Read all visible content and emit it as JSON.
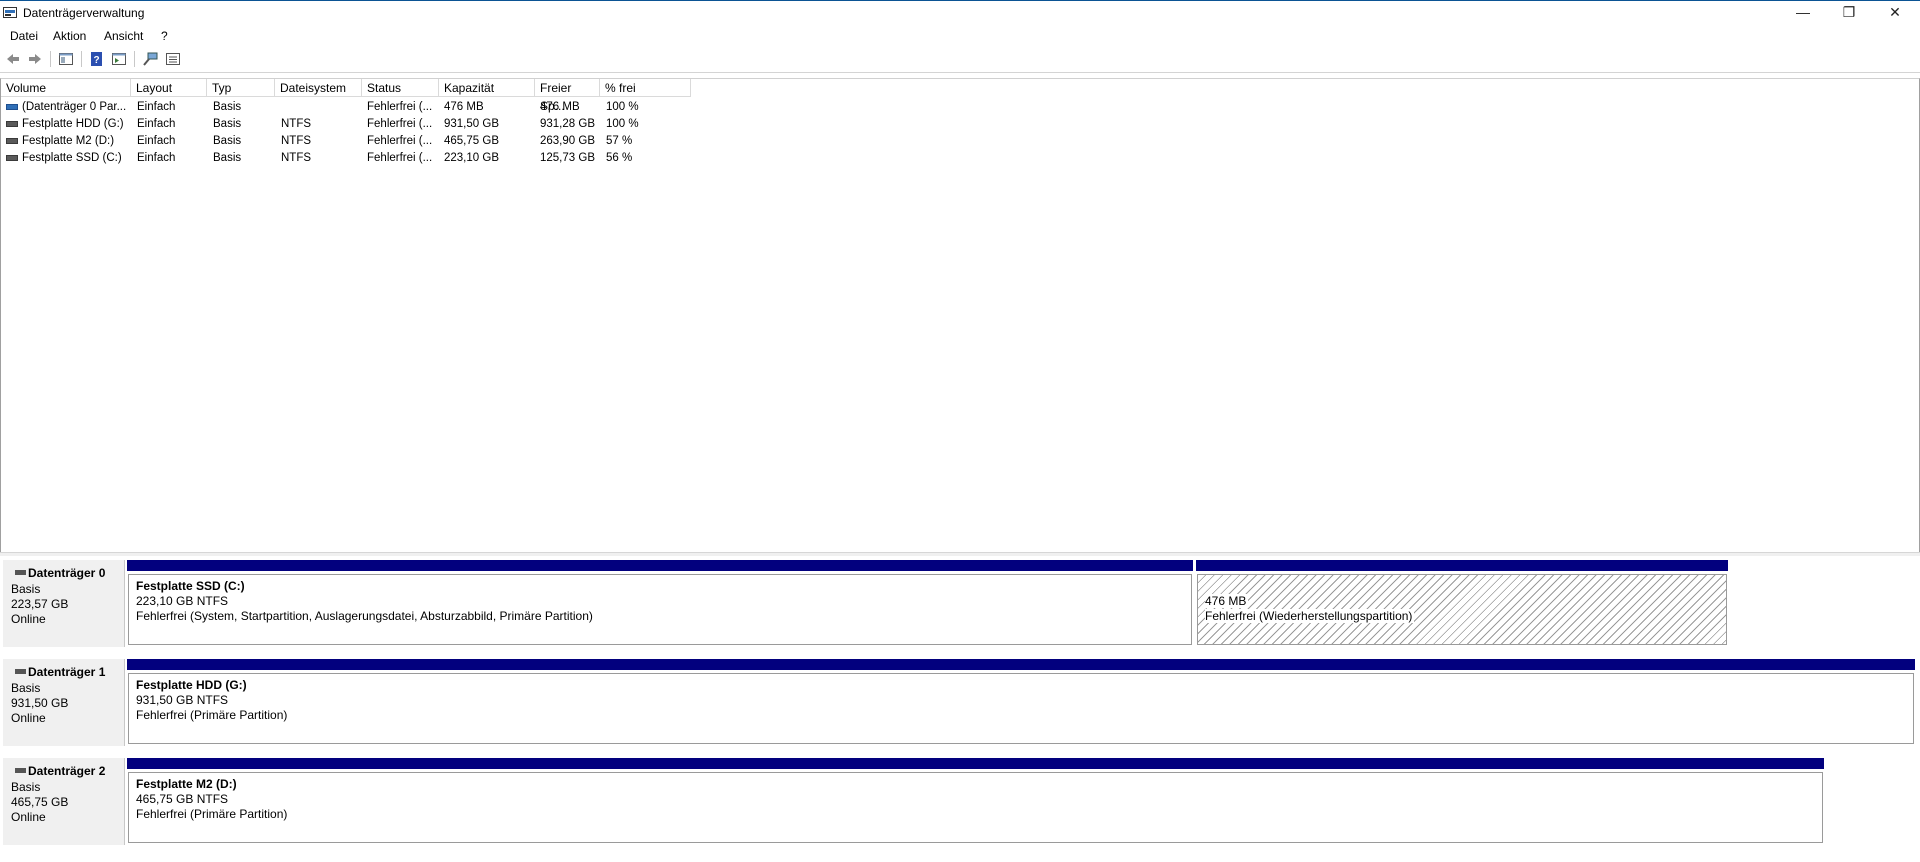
{
  "window": {
    "title": "Datenträgerverwaltung",
    "controls": {
      "minimize": "—",
      "restore": "❐",
      "close": "✕"
    }
  },
  "menu": [
    "Datei",
    "Aktion",
    "Ansicht",
    "?"
  ],
  "toolbar": {
    "icons": [
      "back-icon",
      "forward-icon",
      "console-tree-icon",
      "help-icon",
      "properties-icon",
      "connect-icon",
      "settings-icon"
    ]
  },
  "volume_table": {
    "columns": [
      "Volume",
      "Layout",
      "Typ",
      "Dateisystem",
      "Status",
      "Kapazität",
      "Freier Sp...",
      "% frei"
    ],
    "rows": [
      {
        "volume": "(Datenträger 0 Par...",
        "layout": "Einfach",
        "typ": "Basis",
        "dateisystem": "",
        "status": "Fehlerfrei (...",
        "kapazitaet": "476 MB",
        "frei": "476 MB",
        "prozent": "100 %"
      },
      {
        "volume": "Festplatte HDD (G:)",
        "layout": "Einfach",
        "typ": "Basis",
        "dateisystem": "NTFS",
        "status": "Fehlerfrei (...",
        "kapazitaet": "931,50 GB",
        "frei": "931,28 GB",
        "prozent": "100 %"
      },
      {
        "volume": "Festplatte M2 (D:)",
        "layout": "Einfach",
        "typ": "Basis",
        "dateisystem": "NTFS",
        "status": "Fehlerfrei (...",
        "kapazitaet": "465,75 GB",
        "frei": "263,90 GB",
        "prozent": "57 %"
      },
      {
        "volume": "Festplatte SSD (C:)",
        "layout": "Einfach",
        "typ": "Basis",
        "dateisystem": "NTFS",
        "status": "Fehlerfrei (...",
        "kapazitaet": "223,10 GB",
        "frei": "125,73 GB",
        "prozent": "56 %"
      }
    ]
  },
  "disks": [
    {
      "name": "Datenträger 0",
      "type": "Basis",
      "size": "223,57 GB",
      "state": "Online",
      "partitions": [
        {
          "title": "Festplatte SSD  (C:)",
          "size": "223,10 GB NTFS",
          "status": "Fehlerfrei (System, Startpartition, Auslagerungsdatei, Absturzabbild, Primäre Partition)"
        },
        {
          "title": "",
          "size": "476 MB",
          "status": "Fehlerfrei (Wiederherstellungspartition)"
        }
      ]
    },
    {
      "name": "Datenträger 1",
      "type": "Basis",
      "size": "931,50 GB",
      "state": "Online",
      "partitions": [
        {
          "title": "Festplatte HDD  (G:)",
          "size": "931,50 GB NTFS",
          "status": "Fehlerfrei (Primäre Partition)"
        }
      ]
    },
    {
      "name": "Datenträger 2",
      "type": "Basis",
      "size": "465,75 GB",
      "state": "Online",
      "partitions": [
        {
          "title": "Festplatte M2  (D:)",
          "size": "465,75 GB NTFS",
          "status": "Fehlerfrei (Primäre Partition)"
        }
      ]
    }
  ],
  "colors": {
    "partition_bar": "#02007e",
    "titlebar_accent": "#0b5394"
  }
}
